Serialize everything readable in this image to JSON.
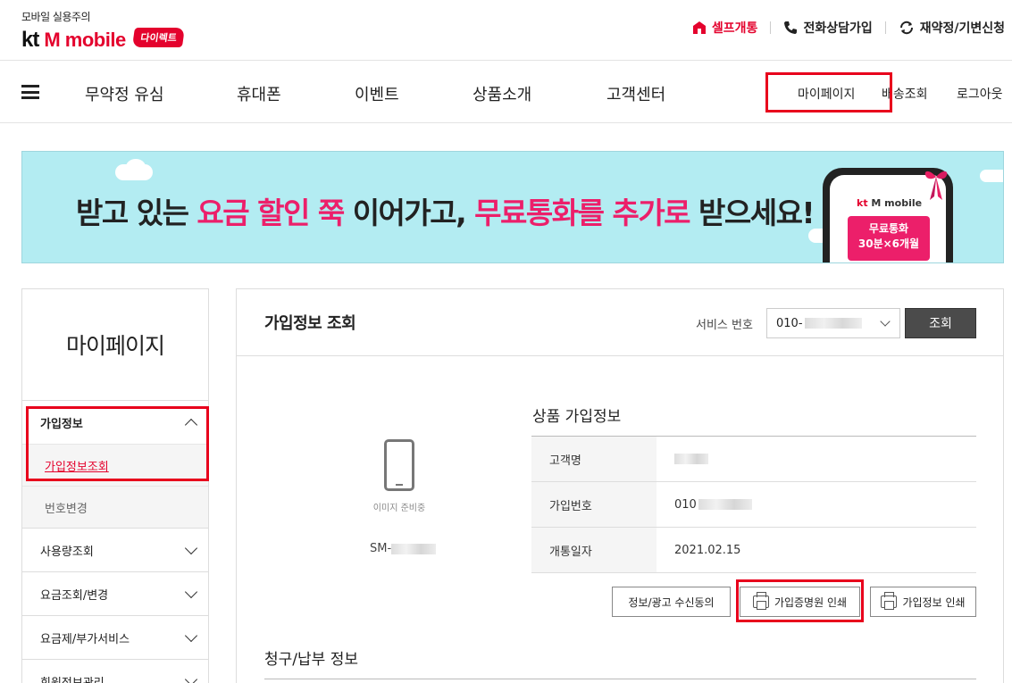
{
  "header": {
    "logo_tagline": "모바일 실용주의",
    "logo_kt": "kt",
    "logo_mmobile": "M mobile",
    "logo_badge": "다이렉트",
    "util_links": {
      "self_open": "셀프개통",
      "phone_signup": "전화상담가입",
      "renewal": "재약정/기변신청"
    }
  },
  "gnb": {
    "menu": [
      "무약정 유심",
      "휴대폰",
      "이벤트",
      "상품소개",
      "고객센터"
    ],
    "right": {
      "mypage": "마이페이지",
      "delivery": "배송조회",
      "logout": "로그아웃"
    }
  },
  "banner": {
    "text_1": "받고 있는 ",
    "text_2": "요금 할인 쭉",
    "text_3": " 이어가고, ",
    "text_4": "무료통화를 추가로",
    "text_5": " 받으세요!",
    "phone_brand_kt": "kt",
    "phone_brand_rest": " M mobile",
    "ticket_line1": "무료통화",
    "ticket_line2": "30분×6개월"
  },
  "sidebar": {
    "title": "마이페이지",
    "groups": [
      {
        "label": "가입정보",
        "sub": [
          "가입정보조회",
          "번호변경"
        ]
      },
      {
        "label": "사용량조회"
      },
      {
        "label": "요금조회/변경"
      },
      {
        "label": "요금제/부가서비스"
      },
      {
        "label": "회원정보관리"
      }
    ]
  },
  "main": {
    "title": "가입정보 조회",
    "service_label": "서비스 번호",
    "service_value": "010-",
    "search_button": "조회",
    "device_caption": "이미지 준비중",
    "model_prefix": "SM-",
    "product_info_title": "상품 가입정보",
    "rows": [
      {
        "key": "고객명",
        "value": ""
      },
      {
        "key": "가입번호",
        "value": "010"
      },
      {
        "key": "개통일자",
        "value": "2021.02.15"
      }
    ],
    "buttons": {
      "consent": "정보/광고 수신동의",
      "cert_print": "가입증명원 인쇄",
      "info_print": "가입정보 인쇄"
    },
    "billing_title": "청구/납부 정보"
  },
  "colors": {
    "brand_red": "#e4022d",
    "highlight_red": "#e8001c",
    "banner_bg": "#b3ecf2",
    "banner_pink": "#ec1f6a"
  }
}
